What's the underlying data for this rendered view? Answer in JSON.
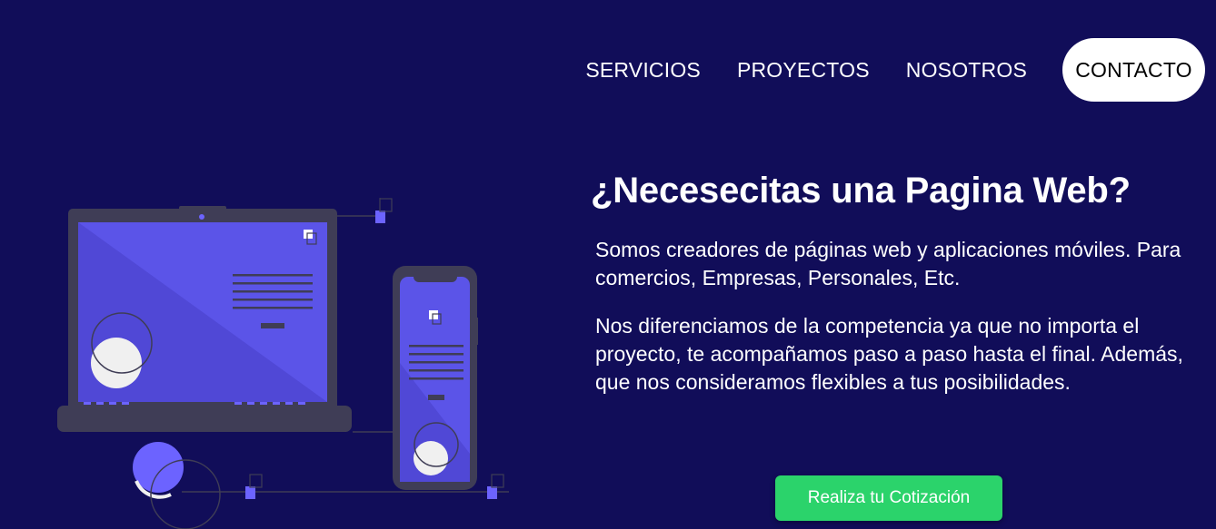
{
  "nav": {
    "items": [
      "SERVICIOS",
      "PROYECTOS",
      "NOSOTROS"
    ],
    "cta": "CONTACTO"
  },
  "hero": {
    "title": "¿Necesecitas una Pagina Web?",
    "paragraph1": "Somos creadores de páginas web y aplicaciones móviles. Para comercios, Empresas, Personales, Etc.",
    "paragraph2": "Nos diferenciamos de la competencia ya que no importa el proyecto, te acompañamos paso a paso hasta el final. Además, que nos consideramos flexibles a tus posibilidades.",
    "button": "Realiza tu Cotización"
  },
  "colors": {
    "background": "#110d59",
    "accent": "#6c63ff",
    "button": "#2bd36b",
    "device": "#3f3d56"
  },
  "illustration": "laptop-and-phone-illustration"
}
